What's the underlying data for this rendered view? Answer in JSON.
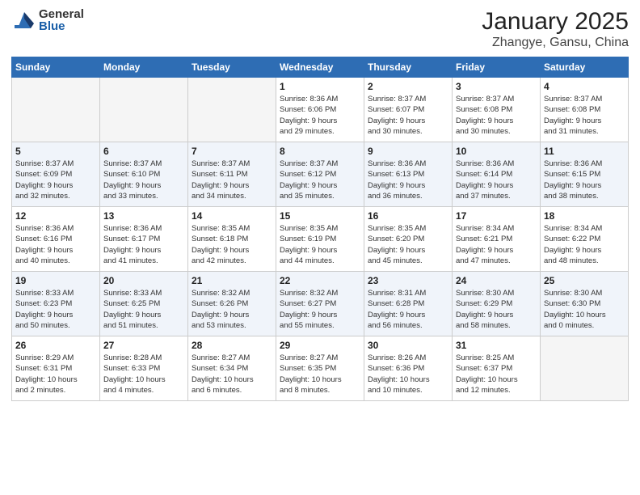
{
  "logo": {
    "general": "General",
    "blue": "Blue"
  },
  "header": {
    "month": "January 2025",
    "location": "Zhangye, Gansu, China"
  },
  "weekdays": [
    "Sunday",
    "Monday",
    "Tuesday",
    "Wednesday",
    "Thursday",
    "Friday",
    "Saturday"
  ],
  "weeks": [
    [
      {
        "day": "",
        "info": ""
      },
      {
        "day": "",
        "info": ""
      },
      {
        "day": "",
        "info": ""
      },
      {
        "day": "1",
        "info": "Sunrise: 8:36 AM\nSunset: 6:06 PM\nDaylight: 9 hours\nand 29 minutes."
      },
      {
        "day": "2",
        "info": "Sunrise: 8:37 AM\nSunset: 6:07 PM\nDaylight: 9 hours\nand 30 minutes."
      },
      {
        "day": "3",
        "info": "Sunrise: 8:37 AM\nSunset: 6:08 PM\nDaylight: 9 hours\nand 30 minutes."
      },
      {
        "day": "4",
        "info": "Sunrise: 8:37 AM\nSunset: 6:08 PM\nDaylight: 9 hours\nand 31 minutes."
      }
    ],
    [
      {
        "day": "5",
        "info": "Sunrise: 8:37 AM\nSunset: 6:09 PM\nDaylight: 9 hours\nand 32 minutes."
      },
      {
        "day": "6",
        "info": "Sunrise: 8:37 AM\nSunset: 6:10 PM\nDaylight: 9 hours\nand 33 minutes."
      },
      {
        "day": "7",
        "info": "Sunrise: 8:37 AM\nSunset: 6:11 PM\nDaylight: 9 hours\nand 34 minutes."
      },
      {
        "day": "8",
        "info": "Sunrise: 8:37 AM\nSunset: 6:12 PM\nDaylight: 9 hours\nand 35 minutes."
      },
      {
        "day": "9",
        "info": "Sunrise: 8:36 AM\nSunset: 6:13 PM\nDaylight: 9 hours\nand 36 minutes."
      },
      {
        "day": "10",
        "info": "Sunrise: 8:36 AM\nSunset: 6:14 PM\nDaylight: 9 hours\nand 37 minutes."
      },
      {
        "day": "11",
        "info": "Sunrise: 8:36 AM\nSunset: 6:15 PM\nDaylight: 9 hours\nand 38 minutes."
      }
    ],
    [
      {
        "day": "12",
        "info": "Sunrise: 8:36 AM\nSunset: 6:16 PM\nDaylight: 9 hours\nand 40 minutes."
      },
      {
        "day": "13",
        "info": "Sunrise: 8:36 AM\nSunset: 6:17 PM\nDaylight: 9 hours\nand 41 minutes."
      },
      {
        "day": "14",
        "info": "Sunrise: 8:35 AM\nSunset: 6:18 PM\nDaylight: 9 hours\nand 42 minutes."
      },
      {
        "day": "15",
        "info": "Sunrise: 8:35 AM\nSunset: 6:19 PM\nDaylight: 9 hours\nand 44 minutes."
      },
      {
        "day": "16",
        "info": "Sunrise: 8:35 AM\nSunset: 6:20 PM\nDaylight: 9 hours\nand 45 minutes."
      },
      {
        "day": "17",
        "info": "Sunrise: 8:34 AM\nSunset: 6:21 PM\nDaylight: 9 hours\nand 47 minutes."
      },
      {
        "day": "18",
        "info": "Sunrise: 8:34 AM\nSunset: 6:22 PM\nDaylight: 9 hours\nand 48 minutes."
      }
    ],
    [
      {
        "day": "19",
        "info": "Sunrise: 8:33 AM\nSunset: 6:23 PM\nDaylight: 9 hours\nand 50 minutes."
      },
      {
        "day": "20",
        "info": "Sunrise: 8:33 AM\nSunset: 6:25 PM\nDaylight: 9 hours\nand 51 minutes."
      },
      {
        "day": "21",
        "info": "Sunrise: 8:32 AM\nSunset: 6:26 PM\nDaylight: 9 hours\nand 53 minutes."
      },
      {
        "day": "22",
        "info": "Sunrise: 8:32 AM\nSunset: 6:27 PM\nDaylight: 9 hours\nand 55 minutes."
      },
      {
        "day": "23",
        "info": "Sunrise: 8:31 AM\nSunset: 6:28 PM\nDaylight: 9 hours\nand 56 minutes."
      },
      {
        "day": "24",
        "info": "Sunrise: 8:30 AM\nSunset: 6:29 PM\nDaylight: 9 hours\nand 58 minutes."
      },
      {
        "day": "25",
        "info": "Sunrise: 8:30 AM\nSunset: 6:30 PM\nDaylight: 10 hours\nand 0 minutes."
      }
    ],
    [
      {
        "day": "26",
        "info": "Sunrise: 8:29 AM\nSunset: 6:31 PM\nDaylight: 10 hours\nand 2 minutes."
      },
      {
        "day": "27",
        "info": "Sunrise: 8:28 AM\nSunset: 6:33 PM\nDaylight: 10 hours\nand 4 minutes."
      },
      {
        "day": "28",
        "info": "Sunrise: 8:27 AM\nSunset: 6:34 PM\nDaylight: 10 hours\nand 6 minutes."
      },
      {
        "day": "29",
        "info": "Sunrise: 8:27 AM\nSunset: 6:35 PM\nDaylight: 10 hours\nand 8 minutes."
      },
      {
        "day": "30",
        "info": "Sunrise: 8:26 AM\nSunset: 6:36 PM\nDaylight: 10 hours\nand 10 minutes."
      },
      {
        "day": "31",
        "info": "Sunrise: 8:25 AM\nSunset: 6:37 PM\nDaylight: 10 hours\nand 12 minutes."
      },
      {
        "day": "",
        "info": ""
      }
    ]
  ]
}
